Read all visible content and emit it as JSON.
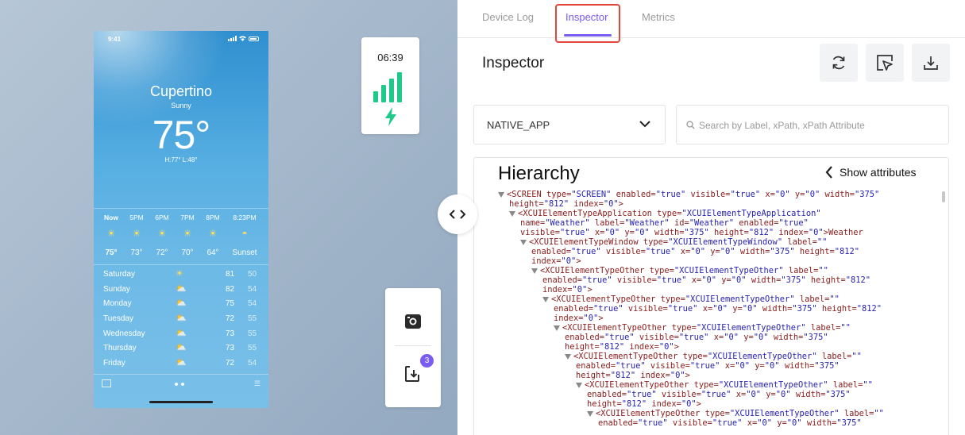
{
  "phone": {
    "status_time": "9:41",
    "city": "Cupertino",
    "condition": "Sunny",
    "temperature": "75°",
    "hi_lo": "H:77°  L:48°",
    "hourly": [
      {
        "label": "Now",
        "icon": "sun-icon",
        "temp": "75°"
      },
      {
        "label": "5PM",
        "icon": "sun-icon",
        "temp": "73°"
      },
      {
        "label": "6PM",
        "icon": "sun-icon",
        "temp": "72°"
      },
      {
        "label": "7PM",
        "icon": "sun-icon",
        "temp": "70°"
      },
      {
        "label": "8PM",
        "icon": "sun-icon",
        "temp": "64°"
      },
      {
        "label": "8:23PM",
        "icon": "sunset-icon",
        "temp": "Sunset"
      }
    ],
    "daily": [
      {
        "day": "Saturday",
        "icon": "sun-icon",
        "high": "81",
        "low": "50"
      },
      {
        "day": "Sunday",
        "icon": "partly-cloudy-icon",
        "high": "82",
        "low": "54"
      },
      {
        "day": "Monday",
        "icon": "partly-cloudy-icon",
        "high": "75",
        "low": "54"
      },
      {
        "day": "Tuesday",
        "icon": "partly-cloudy-icon",
        "high": "72",
        "low": "55"
      },
      {
        "day": "Wednesday",
        "icon": "partly-cloudy-icon",
        "high": "73",
        "low": "55"
      },
      {
        "day": "Thursday",
        "icon": "partly-cloudy-icon",
        "high": "73",
        "low": "55"
      },
      {
        "day": "Friday",
        "icon": "partly-cloudy-icon",
        "high": "72",
        "low": "54"
      }
    ]
  },
  "battery_card": {
    "time": "06:39",
    "signal_color": "#1ec98a"
  },
  "action_card": {
    "badge_count": "3"
  },
  "tabs": [
    {
      "label": "Device Log"
    },
    {
      "label": "Inspector"
    },
    {
      "label": "Metrics"
    }
  ],
  "accent_color": "#7a5cf0",
  "inspector": {
    "title": "Inspector",
    "tools": [
      "refresh-icon",
      "select-element-icon",
      "download-icon"
    ],
    "context_select": {
      "value": "NATIVE_APP"
    },
    "search": {
      "placeholder": "Search by Label, xPath, xPath Attribute"
    },
    "hierarchy_title": "Hierarchy",
    "show_attributes_label": "Show attributes",
    "xml_lines": [
      {
        "indent": 0,
        "tri": true,
        "parts": [
          [
            "tg",
            "<SCREEN"
          ],
          [
            "an",
            " type="
          ],
          [
            "av",
            "\"SCREEN\""
          ],
          [
            "an",
            " enabled="
          ],
          [
            "av",
            "\"true\""
          ],
          [
            "an",
            " visible="
          ],
          [
            "av",
            "\"true\""
          ],
          [
            "an",
            " x="
          ],
          [
            "av",
            "\"0\""
          ],
          [
            "an",
            " y="
          ],
          [
            "av",
            "\"0\""
          ],
          [
            "an",
            " width="
          ],
          [
            "av",
            "\"375\""
          ]
        ]
      },
      {
        "indent": 0,
        "tri": false,
        "parts": [
          [
            "an",
            " height="
          ],
          [
            "av",
            "\"812\""
          ],
          [
            "an",
            " index="
          ],
          [
            "av",
            "\"0\""
          ],
          [
            "tg",
            ">"
          ]
        ]
      },
      {
        "indent": 1,
        "tri": true,
        "parts": [
          [
            "tg",
            "<XCUIElementTypeApplication"
          ],
          [
            "an",
            " type="
          ],
          [
            "av",
            "\"XCUIElementTypeApplication\""
          ]
        ]
      },
      {
        "indent": 1,
        "tri": false,
        "parts": [
          [
            "an",
            "  name="
          ],
          [
            "av",
            "\"Weather\""
          ],
          [
            "an",
            " label="
          ],
          [
            "av",
            "\"Weather\""
          ],
          [
            "an",
            " id="
          ],
          [
            "av",
            "\"Weather\""
          ],
          [
            "an",
            " enabled="
          ],
          [
            "av",
            "\"true\""
          ]
        ]
      },
      {
        "indent": 1,
        "tri": false,
        "parts": [
          [
            "an",
            "  visible="
          ],
          [
            "av",
            "\"true\""
          ],
          [
            "an",
            " x="
          ],
          [
            "av",
            "\"0\""
          ],
          [
            "an",
            " y="
          ],
          [
            "av",
            "\"0\""
          ],
          [
            "an",
            " width="
          ],
          [
            "av",
            "\"375\""
          ],
          [
            "an",
            " height="
          ],
          [
            "av",
            "\"812\""
          ],
          [
            "an",
            " index="
          ],
          [
            "av",
            "\"0\""
          ],
          [
            "tg",
            ">Weather"
          ]
        ]
      },
      {
        "indent": 2,
        "tri": true,
        "parts": [
          [
            "tg",
            "<XCUIElementTypeWindow"
          ],
          [
            "an",
            " type="
          ],
          [
            "av",
            "\"XCUIElementTypeWindow\""
          ],
          [
            "an",
            " label="
          ],
          [
            "av",
            "\"\""
          ]
        ]
      },
      {
        "indent": 2,
        "tri": false,
        "parts": [
          [
            "an",
            "  enabled="
          ],
          [
            "av",
            "\"true\""
          ],
          [
            "an",
            " visible="
          ],
          [
            "av",
            "\"true\""
          ],
          [
            "an",
            " x="
          ],
          [
            "av",
            "\"0\""
          ],
          [
            "an",
            " y="
          ],
          [
            "av",
            "\"0\""
          ],
          [
            "an",
            " width="
          ],
          [
            "av",
            "\"375\""
          ],
          [
            "an",
            " height="
          ],
          [
            "av",
            "\"812\""
          ]
        ]
      },
      {
        "indent": 2,
        "tri": false,
        "parts": [
          [
            "an",
            "  index="
          ],
          [
            "av",
            "\"0\""
          ],
          [
            "tg",
            ">"
          ]
        ]
      },
      {
        "indent": 3,
        "tri": true,
        "parts": [
          [
            "tg",
            "<XCUIElementTypeOther"
          ],
          [
            "an",
            " type="
          ],
          [
            "av",
            "\"XCUIElementTypeOther\""
          ],
          [
            "an",
            " label="
          ],
          [
            "av",
            "\"\""
          ]
        ]
      },
      {
        "indent": 3,
        "tri": false,
        "parts": [
          [
            "an",
            "  enabled="
          ],
          [
            "av",
            "\"true\""
          ],
          [
            "an",
            " visible="
          ],
          [
            "av",
            "\"true\""
          ],
          [
            "an",
            " x="
          ],
          [
            "av",
            "\"0\""
          ],
          [
            "an",
            " y="
          ],
          [
            "av",
            "\"0\""
          ],
          [
            "an",
            " width="
          ],
          [
            "av",
            "\"375\""
          ],
          [
            "an",
            " height="
          ],
          [
            "av",
            "\"812\""
          ]
        ]
      },
      {
        "indent": 3,
        "tri": false,
        "parts": [
          [
            "an",
            "  index="
          ],
          [
            "av",
            "\"0\""
          ],
          [
            "tg",
            ">"
          ]
        ]
      },
      {
        "indent": 4,
        "tri": true,
        "parts": [
          [
            "tg",
            "<XCUIElementTypeOther"
          ],
          [
            "an",
            " type="
          ],
          [
            "av",
            "\"XCUIElementTypeOther\""
          ],
          [
            "an",
            " label="
          ],
          [
            "av",
            "\"\""
          ]
        ]
      },
      {
        "indent": 4,
        "tri": false,
        "parts": [
          [
            "an",
            "  enabled="
          ],
          [
            "av",
            "\"true\""
          ],
          [
            "an",
            " visible="
          ],
          [
            "av",
            "\"true\""
          ],
          [
            "an",
            " x="
          ],
          [
            "av",
            "\"0\""
          ],
          [
            "an",
            " y="
          ],
          [
            "av",
            "\"0\""
          ],
          [
            "an",
            " width="
          ],
          [
            "av",
            "\"375\""
          ],
          [
            "an",
            " height="
          ],
          [
            "av",
            "\"812\""
          ]
        ]
      },
      {
        "indent": 4,
        "tri": false,
        "parts": [
          [
            "an",
            "  index="
          ],
          [
            "av",
            "\"0\""
          ],
          [
            "tg",
            ">"
          ]
        ]
      },
      {
        "indent": 5,
        "tri": true,
        "parts": [
          [
            "tg",
            "<XCUIElementTypeOther"
          ],
          [
            "an",
            " type="
          ],
          [
            "av",
            "\"XCUIElementTypeOther\""
          ],
          [
            "an",
            " label="
          ],
          [
            "av",
            "\"\""
          ]
        ]
      },
      {
        "indent": 5,
        "tri": false,
        "parts": [
          [
            "an",
            "  enabled="
          ],
          [
            "av",
            "\"true\""
          ],
          [
            "an",
            " visible="
          ],
          [
            "av",
            "\"true\""
          ],
          [
            "an",
            " x="
          ],
          [
            "av",
            "\"0\""
          ],
          [
            "an",
            " y="
          ],
          [
            "av",
            "\"0\""
          ],
          [
            "an",
            " width="
          ],
          [
            "av",
            "\"375\""
          ]
        ]
      },
      {
        "indent": 5,
        "tri": false,
        "parts": [
          [
            "an",
            "  height="
          ],
          [
            "av",
            "\"812\""
          ],
          [
            "an",
            " index="
          ],
          [
            "av",
            "\"0\""
          ],
          [
            "tg",
            ">"
          ]
        ]
      },
      {
        "indent": 6,
        "tri": true,
        "parts": [
          [
            "tg",
            "<XCUIElementTypeOther"
          ],
          [
            "an",
            " type="
          ],
          [
            "av",
            "\"XCUIElementTypeOther\""
          ],
          [
            "an",
            " label="
          ],
          [
            "av",
            "\"\""
          ]
        ]
      },
      {
        "indent": 6,
        "tri": false,
        "parts": [
          [
            "an",
            "  enabled="
          ],
          [
            "av",
            "\"true\""
          ],
          [
            "an",
            " visible="
          ],
          [
            "av",
            "\"true\""
          ],
          [
            "an",
            " x="
          ],
          [
            "av",
            "\"0\""
          ],
          [
            "an",
            " y="
          ],
          [
            "av",
            "\"0\""
          ],
          [
            "an",
            " width="
          ],
          [
            "av",
            "\"375\""
          ]
        ]
      },
      {
        "indent": 6,
        "tri": false,
        "parts": [
          [
            "an",
            "  height="
          ],
          [
            "av",
            "\"812\""
          ],
          [
            "an",
            " index="
          ],
          [
            "av",
            "\"0\""
          ],
          [
            "tg",
            ">"
          ]
        ]
      },
      {
        "indent": 7,
        "tri": true,
        "parts": [
          [
            "tg",
            "<XCUIElementTypeOther"
          ],
          [
            "an",
            " type="
          ],
          [
            "av",
            "\"XCUIElementTypeOther\""
          ],
          [
            "an",
            " label="
          ],
          [
            "av",
            "\"\""
          ]
        ]
      },
      {
        "indent": 7,
        "tri": false,
        "parts": [
          [
            "an",
            "  enabled="
          ],
          [
            "av",
            "\"true\""
          ],
          [
            "an",
            " visible="
          ],
          [
            "av",
            "\"true\""
          ],
          [
            "an",
            " x="
          ],
          [
            "av",
            "\"0\""
          ],
          [
            "an",
            " y="
          ],
          [
            "av",
            "\"0\""
          ],
          [
            "an",
            " width="
          ],
          [
            "av",
            "\"375\""
          ]
        ]
      },
      {
        "indent": 7,
        "tri": false,
        "parts": [
          [
            "an",
            "  height="
          ],
          [
            "av",
            "\"812\""
          ],
          [
            "an",
            " index="
          ],
          [
            "av",
            "\"0\""
          ],
          [
            "tg",
            ">"
          ]
        ]
      },
      {
        "indent": 8,
        "tri": true,
        "parts": [
          [
            "tg",
            "<XCUIElementTypeOther"
          ],
          [
            "an",
            " type="
          ],
          [
            "av",
            "\"XCUIElementTypeOther\""
          ],
          [
            "an",
            " label="
          ],
          [
            "av",
            "\"\""
          ]
        ]
      },
      {
        "indent": 8,
        "tri": false,
        "parts": [
          [
            "an",
            "  enabled="
          ],
          [
            "av",
            "\"true\""
          ],
          [
            "an",
            " visible="
          ],
          [
            "av",
            "\"true\""
          ],
          [
            "an",
            " x="
          ],
          [
            "av",
            "\"0\""
          ],
          [
            "an",
            " y="
          ],
          [
            "av",
            "\"0\""
          ],
          [
            "an",
            " width="
          ],
          [
            "av",
            "\"375\""
          ]
        ]
      }
    ]
  }
}
